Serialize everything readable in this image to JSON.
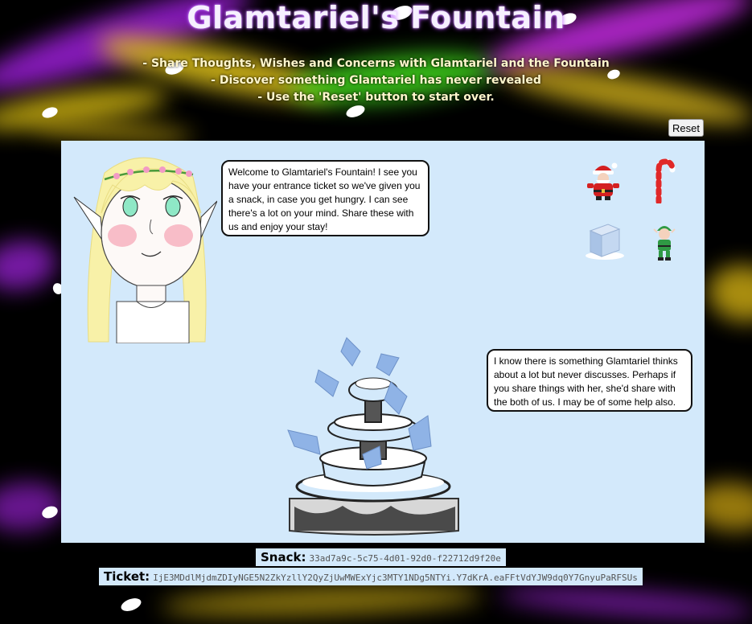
{
  "header": {
    "title": "Glamtariel's Fountain",
    "lines": [
      "- Share Thoughts, Wishes and Concerns with Glamtariel and the Fountain",
      "- Discover something Glamtariel has never revealed",
      "- Use the 'Reset' button to start over."
    ]
  },
  "reset_label": "Reset",
  "stage": {
    "glamtariel_message": "Welcome to Glamtariel's Fountain! I see you have your entrance ticket so we've given you a snack, in case you get hungry. I can see there's a lot on your mind. Share these with us and enjoy your stay!",
    "fountain_message": "I know there is something Glamtariel thinks about a lot but never discusses. Perhaps if you share things with her, she'd share with the both of us. I may be of some help also.",
    "items": [
      {
        "icon": "santa-icon"
      },
      {
        "icon": "candy-cane-icon"
      },
      {
        "icon": "ice-cube-icon"
      },
      {
        "icon": "elf-icon"
      }
    ]
  },
  "footer": {
    "snack_label": "Snack:",
    "snack_value": "33ad7a9c-5c75-4d01-92d0-f22712d9f20e",
    "ticket_label": "Ticket:",
    "ticket_value": "IjE3MDdlMjdmZDIyNGE5N2ZkYzllY2QyZjUwMWExYjc3MTY1NDg5NTYi.Y7dKrA.eaFFtVdYJW9dq0Y7GnyuPaRFSUs"
  },
  "colors": {
    "stage_bg": "#d3e9fb",
    "page_bg": "#000000"
  }
}
